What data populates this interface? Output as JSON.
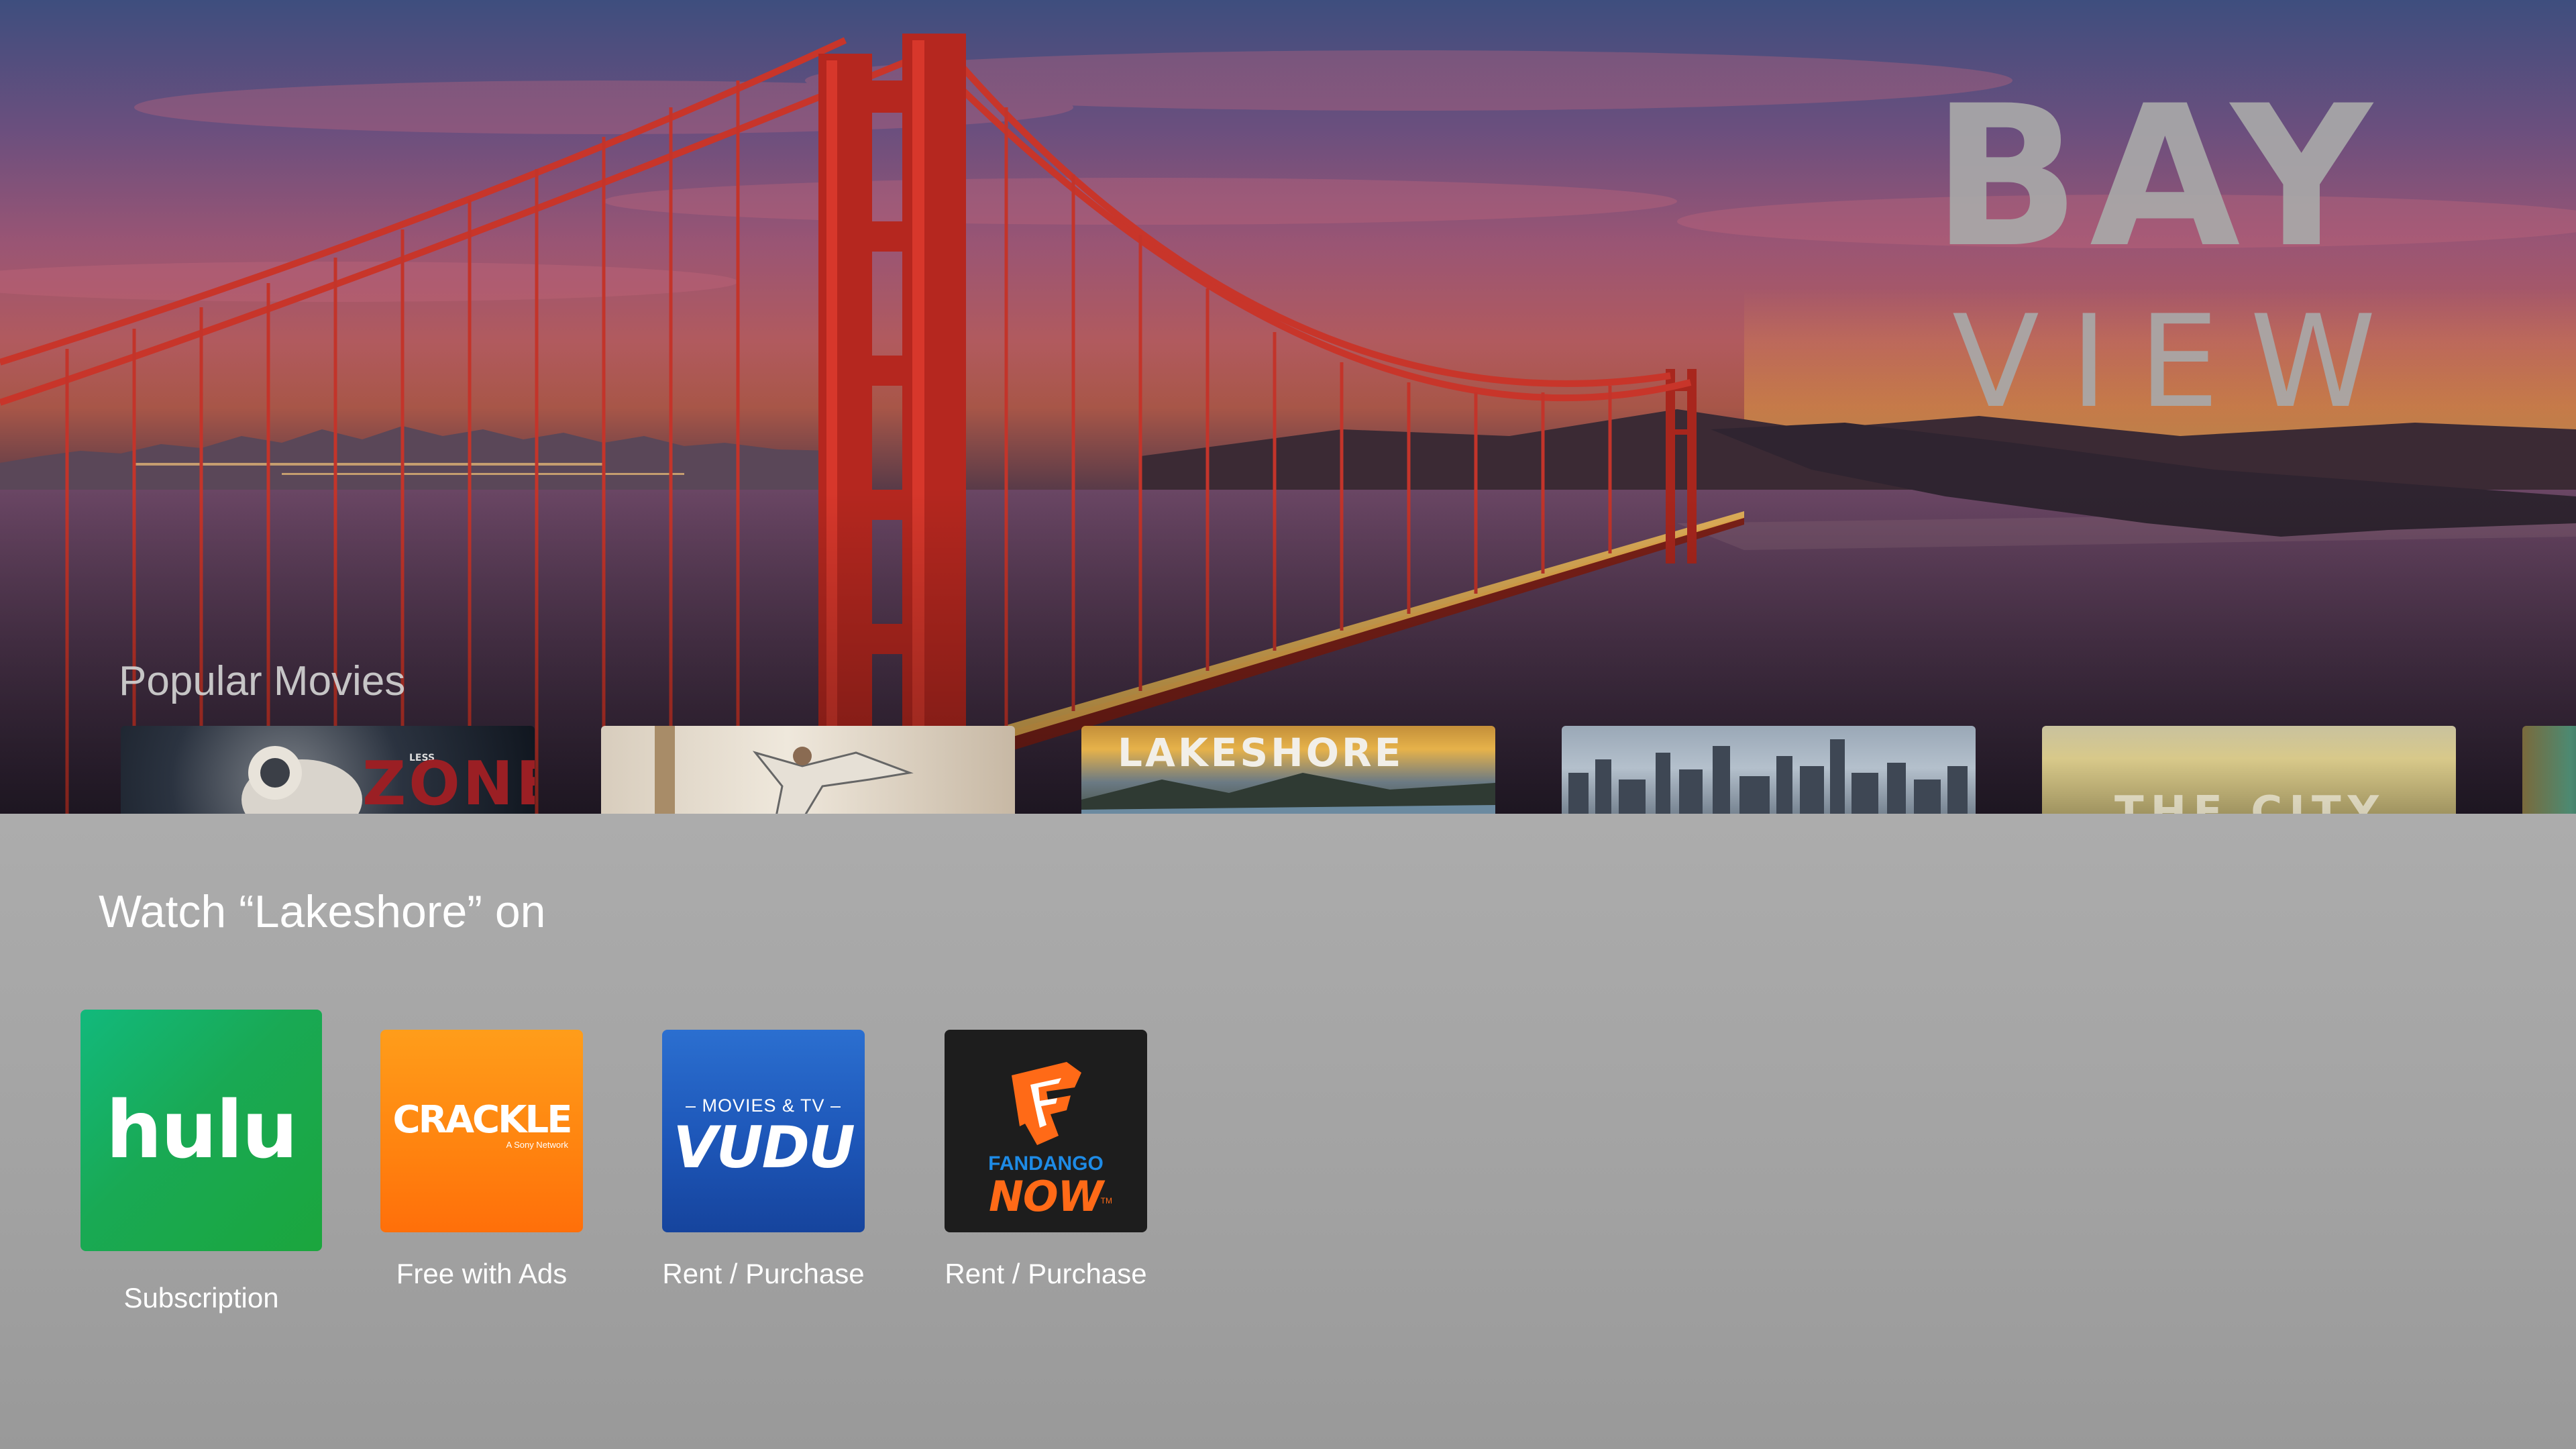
{
  "hero": {
    "logo_line1": "BAY",
    "logo_line2": "VIEW"
  },
  "popular": {
    "title": "Popular Movies",
    "posters": [
      {
        "name": "zone",
        "text_small": "LESS",
        "text": "ZONE"
      },
      {
        "name": "dancer",
        "text_small": "",
        "text": ""
      },
      {
        "name": "lakeshore",
        "text_small": "",
        "text": "LAKESHORE"
      },
      {
        "name": "city-skyline",
        "text_small": "",
        "text": ""
      },
      {
        "name": "the-city",
        "text_small": "",
        "text": "THE CITY"
      }
    ]
  },
  "sheet": {
    "title": "Watch “Lakeshore” on",
    "providers": [
      {
        "name": "hulu",
        "logo": "hulu",
        "sub": "",
        "caption": "Subscription",
        "color": "#1ce783"
      },
      {
        "name": "crackle",
        "logo": "CRACKLE",
        "sub": "A Sony Network",
        "caption": "Free with Ads",
        "color": "#ff8a12"
      },
      {
        "name": "vudu",
        "logo": "VUDU",
        "sub": "– MOVIES & TV –",
        "caption": "Rent / Purchase",
        "color": "#2160c4"
      },
      {
        "name": "fandango-now",
        "logo": "NOW",
        "sub": "FANDANGO",
        "tm": "TM",
        "caption": "Rent / Purchase",
        "color": "#ff6a17"
      }
    ]
  },
  "colors": {
    "sheet_bg": "#a3a3a3",
    "bridge": "#b5271f",
    "text": "#ffffff"
  },
  "icons": [
    "fandango-f-icon",
    "golden-gate-bridge-image"
  ]
}
